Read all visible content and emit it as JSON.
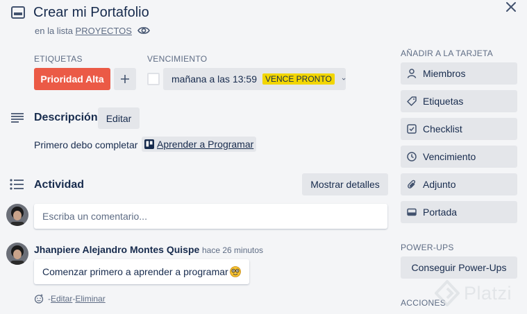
{
  "card": {
    "title": "Crear mi Portafolio",
    "in_list_prefix": "en la lista ",
    "list_name": "PROYECTOS"
  },
  "labels": {
    "section_label": "ETIQUETAS",
    "label_name": "Prioridad Alta",
    "label_color": "#eb5a46",
    "add_icon": "plus-icon"
  },
  "due": {
    "section_label": "VENCIMIENTO",
    "value": "mañana a las 13:59",
    "badge": "VENCE PRONTO",
    "badge_color": "#f2d600"
  },
  "description": {
    "title": "Descripción",
    "edit_label": "Editar",
    "text": "Primero debo completar",
    "link_text": "Aprender a Programar"
  },
  "activity": {
    "title": "Actividad",
    "details_label": "Mostrar detalles",
    "comment_placeholder": "Escriba un comentario...",
    "comment": {
      "author": "Jhanpiere Alejandro Montes Quispe",
      "time": "hace 26 minutos",
      "text": "Comenzar primero a aprender a programar",
      "separator": " - ",
      "edit_label": "Editar",
      "delete_label": "Eliminar"
    }
  },
  "sidebar": {
    "add_title": "AÑADIR A LA TARJETA",
    "add_items": [
      {
        "label": "Miembros",
        "icon": "user-icon"
      },
      {
        "label": "Etiquetas",
        "icon": "tag-icon"
      },
      {
        "label": "Checklist",
        "icon": "checklist-icon"
      },
      {
        "label": "Vencimiento",
        "icon": "clock-icon"
      },
      {
        "label": "Adjunto",
        "icon": "paperclip-icon"
      },
      {
        "label": "Portada",
        "icon": "cover-icon"
      }
    ],
    "powerups_title": "POWER-UPS",
    "powerups_button": "Conseguir Power-Ups",
    "actions_title": "ACCIONES"
  },
  "watermark": {
    "text": "Platzi"
  }
}
